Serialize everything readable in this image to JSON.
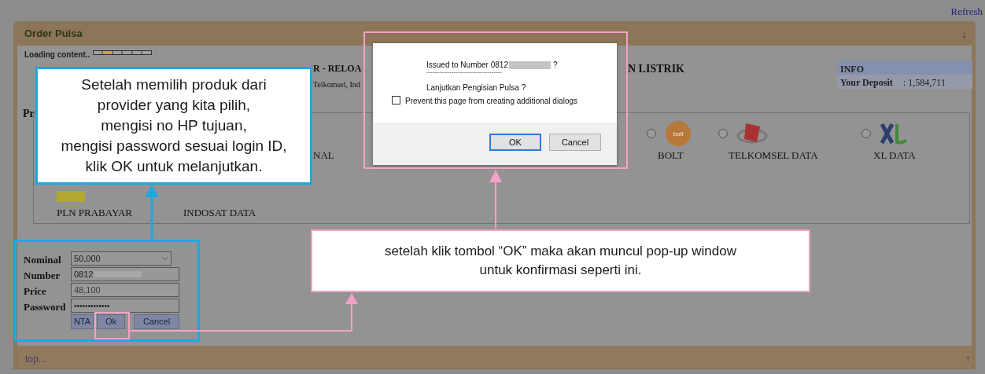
{
  "refresh_link": "Refresh",
  "panel": {
    "title": "Order Pulsa",
    "collapse_icon": "↓",
    "loading_text": "Loading content..",
    "heading_fragments": [
      "R - RELOA",
      "N LISTRIK"
    ],
    "subheading_fragment": "Telkomsel, Ind",
    "section_label_fragment": "Pr",
    "product_label_fragment": "NAL",
    "products": [
      {
        "label": "BOLT",
        "kind": "bolt",
        "selected": false
      },
      {
        "label": "TELKOMSEL DATA",
        "kind": "telkomsel",
        "selected": false
      },
      {
        "label": "XL DATA",
        "kind": "xl",
        "selected": false
      }
    ],
    "products_row_2": [
      {
        "label": "PLN PRABAYAR",
        "kind": "pln"
      },
      {
        "label": "INDOSAT DATA",
        "kind": "none"
      }
    ],
    "info": {
      "title": "INFO",
      "deposit_label": "Your Deposit",
      "deposit_value": ": 1,584,711"
    },
    "form": {
      "fields": [
        {
          "label": "Nominal",
          "kind": "select",
          "value": "50,000",
          "disabled": false
        },
        {
          "label": "Number",
          "kind": "redacted",
          "value": "0812",
          "disabled": false
        },
        {
          "label": "Price",
          "kind": "text",
          "value": "48,100",
          "disabled": true
        },
        {
          "label": "Password",
          "kind": "password",
          "value": "•••••••••••••",
          "disabled": false
        }
      ],
      "buttons": [
        "NTA",
        "Ok",
        "Cancel"
      ]
    },
    "footer": {
      "link": "top...",
      "up_icon": "↑"
    }
  },
  "dialog": {
    "message": "Issued to Number 0812",
    "message_end": "?",
    "separator": "------------------------------------",
    "question": "Lanjutkan Pengisian Pulsa ?",
    "checkbox": {
      "label": "Prevent this page from creating additional dialogs",
      "checked": false
    },
    "buttons": [
      {
        "label": "OK",
        "focused": true
      },
      {
        "label": "Cancel",
        "focused": false
      }
    ]
  },
  "callouts": [
    {
      "kind": "blue",
      "text": "Setelah memilih produk dari\nprovider yang kita pilih,\nmengisi no HP tujuan,\nmengisi password sesuai login ID,\nklik OK untuk melanjutkan."
    },
    {
      "kind": "pink",
      "text": "setelah klik tombol “OK” maka akan muncul pop-up window\nuntuk konfirmasi seperti ini."
    }
  ]
}
